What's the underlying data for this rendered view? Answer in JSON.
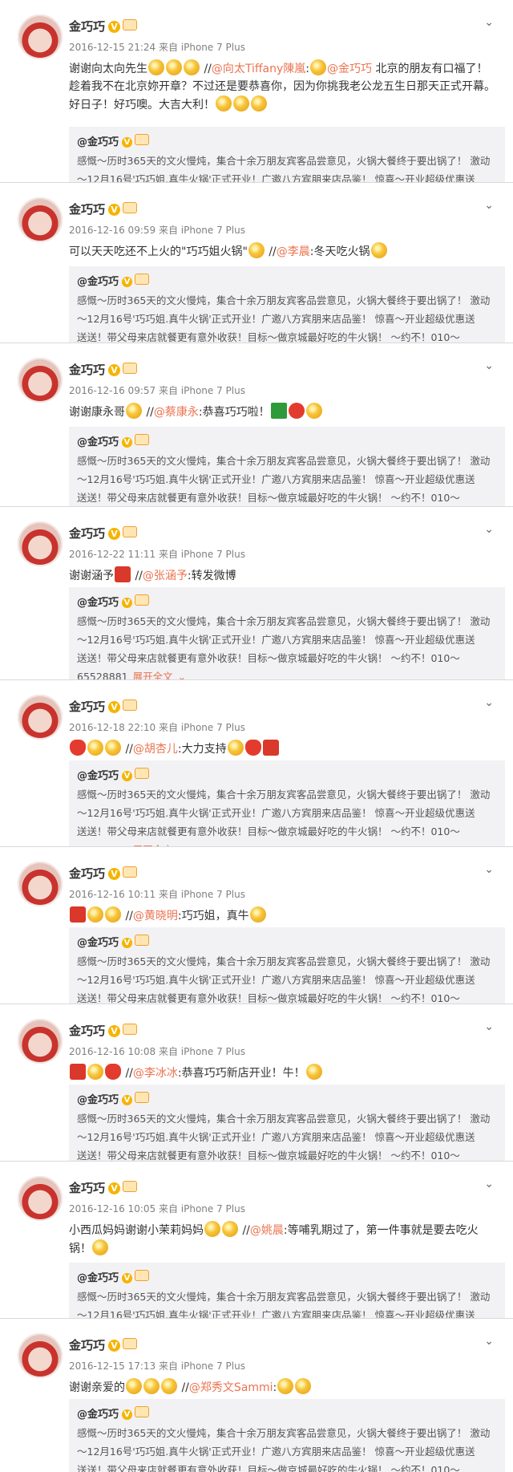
{
  "feed": {
    "username": "金巧巧",
    "verified_mark": "V",
    "quoted_author": "@金巧巧",
    "quoted_lines": [
      "感慨～历时365天的文火慢炖，集合十余万朋友宾客品尝意见，火锅大餐终于要出锅了！ 激动",
      "～12月16号'巧巧姐.真牛火锅'正式开业！广邀八方宾朋来店品鉴！ 惊喜～开业超级优惠送",
      "送送！带父母来店就餐更有意外收获！目标～做京城最好吃的牛火锅！ ～约不！010～",
      "65528881"
    ],
    "expand_label": "展开全文",
    "posts": [
      {
        "meta": "2016-12-15 21:24 来自 iPhone 7 Plus",
        "text_parts": [
          "谢谢向太向先生",
          " //",
          "@向太Tiffany陳嵐",
          ":",
          "@金巧巧",
          " 北京的朋友有口福了！趁着我不在北京妳开章？不过还是要恭喜你，因为你挑我老公龙五生日那天正式开幕。好日子！好巧噢。大吉大利！"
        ]
      },
      {
        "meta": "2016-12-16 09:59 来自 iPhone 7 Plus",
        "text_parts": [
          "可以天天吃还不上火的\"巧巧姐火锅\"",
          " //",
          "@李晨",
          ":冬天吃火锅"
        ]
      },
      {
        "meta": "2016-12-16 09:57 来自 iPhone 7 Plus",
        "text_parts": [
          "谢谢康永哥",
          " //",
          "@蔡康永",
          ":恭喜巧巧啦！"
        ]
      },
      {
        "meta": "2016-12-22 11:11 来自 iPhone 7 Plus",
        "text_parts": [
          "谢谢涵予",
          " //",
          "@张涵予",
          ":转发微博"
        ]
      },
      {
        "meta": "2016-12-18 22:10 来自 iPhone 7 Plus",
        "text_parts": [
          "",
          " //",
          "@胡杏儿",
          ":大力支持"
        ]
      },
      {
        "meta": "2016-12-16 10:11 来自 iPhone 7 Plus",
        "text_parts": [
          "",
          " //",
          "@黄晓明",
          ":巧巧姐，真牛"
        ]
      },
      {
        "meta": "2016-12-16 10:08 来自 iPhone 7 Plus",
        "text_parts": [
          "",
          " //",
          "@李冰冰",
          ":恭喜巧巧新店开业！牛！"
        ]
      },
      {
        "meta": "2016-12-16 10:05 来自 iPhone 7 Plus",
        "text_parts": [
          "小西瓜妈妈谢谢小茉莉妈妈",
          " //",
          "@姚晨",
          ":等哺乳期过了，第一件事就是要去吃火锅！"
        ]
      },
      {
        "meta": "2016-12-15 17:13 来自 iPhone 7 Plus",
        "text_parts": [
          "谢谢亲爱的",
          " //",
          "@郑秀文Sammi",
          ":"
        ]
      }
    ]
  }
}
